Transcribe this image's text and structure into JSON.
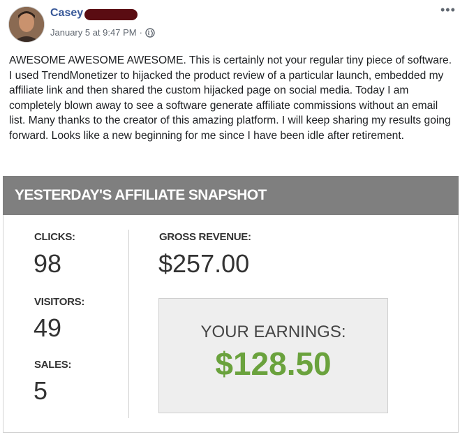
{
  "post": {
    "author": "Casey",
    "timestamp": "January 5 at 9:47 PM",
    "separator": "·",
    "privacy_icon": "globe-icon",
    "more_icon": "more-options-icon",
    "more_label": "•••",
    "text": "AWESOME AWESOME AWESOME. This is certainly not your regular tiny piece of software. I used TrendMonetizer to hijacked the product review of a particular launch, embedded my affiliate link and then shared the custom hijacked page on social media. Today I am completely blown away to see a software generate affiliate commissions without an email list. Many thanks to the creator of this amazing platform. I will keep sharing my results going forward. Looks like a new beginning for me since I have been idle after retirement."
  },
  "snapshot": {
    "title": "YESTERDAY'S AFFILIATE SNAPSHOT",
    "clicks_label": "CLICKS:",
    "clicks_value": "98",
    "visitors_label": "VISITORS:",
    "visitors_value": "49",
    "sales_label": "SALES:",
    "sales_value": "5",
    "gross_label": "GROSS REVENUE:",
    "gross_value": "$257.00",
    "earnings_label": "YOUR EARNINGS:",
    "earnings_value": "$128.50"
  },
  "colors": {
    "author_link": "#385898",
    "header_bar": "#7f7f7f",
    "earnings_green": "#6aa23d"
  }
}
